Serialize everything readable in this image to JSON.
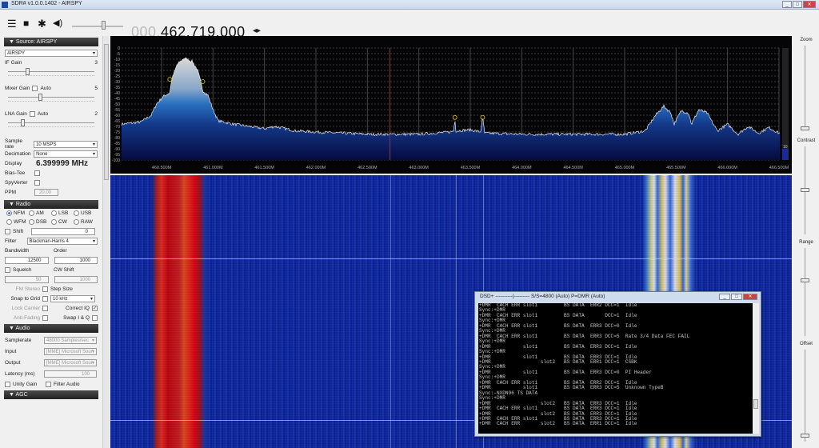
{
  "window": {
    "title": "SDR# v1.0.0.1402 - AIRSPY",
    "min": "_",
    "max": "□",
    "close": "✕"
  },
  "toolbar": {
    "freq_dim": "000.",
    "freq": "462.719.000",
    "arrows": "◂▸"
  },
  "source": {
    "header": "Source: AIRSPY",
    "device": "AIRSPY",
    "if_gain_label": "IF Gain",
    "if_gain": "3",
    "if_gain_level": 0.2,
    "mixer_label": "Mixer Gain",
    "mixer_auto": "Auto",
    "mixer_gain": "5",
    "mixer_level": 0.35,
    "lna_label": "LNA Gain",
    "lna_auto": "Auto",
    "lna_gain": "2",
    "lna_level": 0.15,
    "samplerate_label": "Sample rate",
    "samplerate": "10 MSPS",
    "decimation_label": "Decimation",
    "decimation": "None",
    "display_label": "Display",
    "display": "6.399999 MHz",
    "biastee_label": "Bias-Tee",
    "spyverter_label": "SpyVerter",
    "ppm_label": "PPM",
    "ppm": "20.00"
  },
  "radio": {
    "header": "Radio",
    "modes": [
      "NFM",
      "AM",
      "LSB",
      "USB",
      "WFM",
      "DSB",
      "CW",
      "RAW"
    ],
    "selected": "NFM",
    "shift_label": "Shift",
    "shift": "0",
    "filter_label": "Filter",
    "filter": "Blackman-Harris 4",
    "bandwidth_label": "Bandwidth",
    "bandwidth": "12500",
    "order_label": "Order",
    "order": "1000",
    "squelch_label": "Squelch",
    "cwshift_label": "CW Shift",
    "squelch": "50",
    "cwshift": "1000",
    "fmstereo_label": "FM Stereo",
    "stepsize_label": "Step Size",
    "snap_label": "Snap to Grid",
    "step": "10 kHz",
    "lockcarrier_label": "Lock Carrier",
    "correctiq_label": "Correct IQ",
    "antifading_label": "Anti-Fading",
    "swapiq_label": "Swap I & Q",
    "check": "✓"
  },
  "audio": {
    "header": "Audio",
    "samplerate_label": "Samplerate",
    "samplerate": "48000 Samples/sec",
    "input_label": "Input",
    "input": "[MME] Microsoft Soun",
    "output_label": "Output",
    "output": "[MME] Microsoft Soun",
    "latency_label": "Latency (ms)",
    "latency": "100",
    "unity_label": "Unity Gain",
    "filter_label": "Filter Audio"
  },
  "agc": {
    "header": "AGC"
  },
  "right": {
    "zoom": "Zoom",
    "contrast": "Contrast",
    "range": "Range",
    "offset": "Offset",
    "level": "10"
  },
  "spectrum": {
    "y_ticks": [
      "0",
      "-5",
      "-10",
      "-15",
      "-20",
      "-25",
      "-30",
      "-35",
      "-40",
      "-45",
      "-50",
      "-55",
      "-60",
      "-65",
      "-70",
      "-75",
      "-80",
      "-85",
      "-90",
      "-95",
      "-100"
    ],
    "x_ticks": [
      "460.500M",
      "461.000M",
      "461.500M",
      "462.000M",
      "462.500M",
      "463.000M",
      "463.500M",
      "464.000M",
      "464.500M",
      "465.000M",
      "465.500M",
      "466.000M",
      "466.500M"
    ],
    "tuned_mhz": 462.719,
    "profile_mhz_db": [
      [
        460.11,
        -68
      ],
      [
        460.3,
        -66
      ],
      [
        460.4,
        -60
      ],
      [
        460.45,
        -50
      ],
      [
        460.52,
        -43
      ],
      [
        460.58,
        -40
      ],
      [
        460.6,
        -28
      ],
      [
        460.65,
        -15
      ],
      [
        460.72,
        -9
      ],
      [
        460.8,
        -12
      ],
      [
        460.85,
        -20
      ],
      [
        460.88,
        -30
      ],
      [
        460.9,
        -38
      ],
      [
        460.95,
        -42
      ],
      [
        461.0,
        -55
      ],
      [
        461.05,
        -65
      ],
      [
        461.2,
        -68
      ],
      [
        461.5,
        -72
      ],
      [
        461.6,
        -70
      ],
      [
        461.8,
        -74
      ],
      [
        462.0,
        -75
      ],
      [
        462.5,
        -77
      ],
      [
        463.0,
        -77
      ],
      [
        463.3,
        -75
      ],
      [
        463.34,
        -74
      ],
      [
        463.35,
        -62
      ],
      [
        463.36,
        -74
      ],
      [
        463.5,
        -73
      ],
      [
        463.6,
        -75
      ],
      [
        463.62,
        -62
      ],
      [
        463.64,
        -76
      ],
      [
        464.0,
        -77
      ],
      [
        465.0,
        -77
      ],
      [
        465.2,
        -74
      ],
      [
        465.3,
        -60
      ],
      [
        465.38,
        -52
      ],
      [
        465.45,
        -58
      ],
      [
        465.48,
        -68
      ],
      [
        465.55,
        -56
      ],
      [
        465.62,
        -58
      ],
      [
        465.65,
        -68
      ],
      [
        465.72,
        -55
      ],
      [
        465.8,
        -58
      ],
      [
        465.9,
        -74
      ],
      [
        466.0,
        -68
      ],
      [
        466.1,
        -77
      ],
      [
        466.2,
        -70
      ],
      [
        466.3,
        -76
      ],
      [
        466.4,
        -71
      ],
      [
        466.5,
        -76
      ]
    ],
    "markers_mhz_db": [
      [
        460.58,
        -28
      ],
      [
        460.9,
        -30
      ],
      [
        463.35,
        -62
      ],
      [
        463.62,
        -62
      ]
    ]
  },
  "dsd": {
    "title": "DSD+    ----------|---------  S/S=4800 (Auto) P=DMR (Auto)",
    "lines": [
      "+DMR  CACH ERR slot1         BS DATA  ERR2 DCC=1  Idle",
      "Sync:+DMR",
      "+DMR  CACH ERR slot1         BS DATA       DCC=1  Idle",
      "Sync:+DMR",
      "+DMR  CACH ERR slot1         BS DATA  ERR3 DCC=0  Idle",
      "Sync:+DMR",
      "+DMR  CACH ERR slot1         BS DATA  ERR3 DCC=5  Rate 3/4 Data FEC FAIL",
      "Sync:+DMR",
      "+DMR           slot1         BS DATA  ERR3 DCC=1  Idle",
      "Sync:+DMR",
      "+DMR           slot1         BS DATA  ERR3 DCC=1  Idle",
      "+DMR                 slot2   BS DATA  ERR1 DCC=1  CSBK",
      "Sync:+DMR",
      "+DMR           slot1         BS DATA  ERR3 DCC=0  PI Header",
      "Sync:+DMR",
      "+DMR  CACH ERR slot1         BS DATA  ERR2 DCC=1  Idle",
      "+DMR           slot1         BS DATA  ERR3 DCC=5  Unknown TypeB",
      "Sync:-NXDN96 TS DATA",
      "Sync:+DMR",
      "+DMR                 slot2   BS DATA  ERR3 DCC=1  Idle",
      "+DMR  CACH ERR slot1         BS DATA  ERR3 DCC=1  Idle",
      "+DMR                 slot2   BS DATA  ERR3 DCC=1  Idle",
      "+DMR  CACH ERR slot1         BS DATA  ERR3 DCC=1  Idle",
      "+DMR  CACH ERR       slot2   BS DATA  ERR1 DCC=1  Idle"
    ]
  }
}
